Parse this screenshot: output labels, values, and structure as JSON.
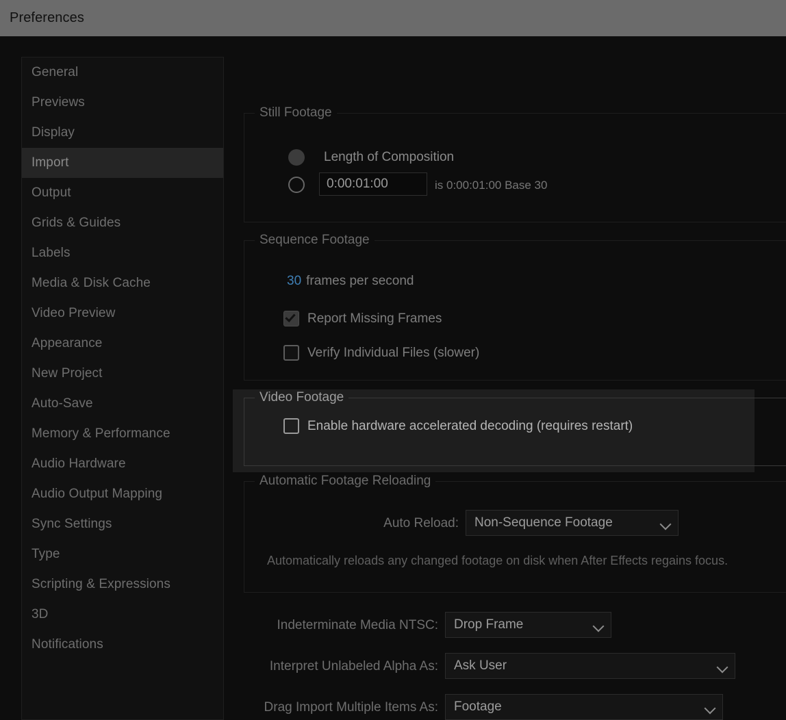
{
  "window": {
    "title": "Preferences"
  },
  "sidebar": {
    "items": [
      {
        "label": "General",
        "selected": false
      },
      {
        "label": "Previews",
        "selected": false
      },
      {
        "label": "Display",
        "selected": false
      },
      {
        "label": "Import",
        "selected": true
      },
      {
        "label": "Output",
        "selected": false
      },
      {
        "label": "Grids & Guides",
        "selected": false
      },
      {
        "label": "Labels",
        "selected": false
      },
      {
        "label": "Media & Disk Cache",
        "selected": false
      },
      {
        "label": "Video Preview",
        "selected": false
      },
      {
        "label": "Appearance",
        "selected": false
      },
      {
        "label": "New Project",
        "selected": false
      },
      {
        "label": "Auto-Save",
        "selected": false
      },
      {
        "label": "Memory & Performance",
        "selected": false
      },
      {
        "label": "Audio Hardware",
        "selected": false
      },
      {
        "label": "Audio Output Mapping",
        "selected": false
      },
      {
        "label": "Sync Settings",
        "selected": false
      },
      {
        "label": "Type",
        "selected": false
      },
      {
        "label": "Scripting & Expressions",
        "selected": false
      },
      {
        "label": "3D",
        "selected": false
      },
      {
        "label": "Notifications",
        "selected": false
      }
    ]
  },
  "still_footage": {
    "title": "Still Footage",
    "option_composition_label": "Length of Composition",
    "option_composition_selected": true,
    "option_custom_selected": false,
    "duration_value": "0:00:01:00",
    "duration_suffix": "is 0:00:01:00  Base 30"
  },
  "sequence_footage": {
    "title": "Sequence Footage",
    "fps_value": "30",
    "fps_label": "frames per second",
    "report_missing_frames_label": "Report Missing Frames",
    "report_missing_frames_checked": true,
    "verify_individual_files_label": "Verify Individual Files (slower)",
    "verify_individual_files_checked": false
  },
  "video_footage": {
    "title": "Video Footage",
    "hardware_decoding_label": "Enable hardware accelerated decoding (requires restart)",
    "hardware_decoding_checked": false,
    "highlighted": true
  },
  "automatic_footage_reloading": {
    "title": "Automatic Footage Reloading",
    "auto_reload_label": "Auto Reload:",
    "auto_reload_value": "Non-Sequence Footage",
    "description": "Automatically reloads any changed footage on disk when After Effects regains focus."
  },
  "bottom_options": {
    "ntsc_label": "Indeterminate Media NTSC:",
    "ntsc_value": "Drop Frame",
    "alpha_label": "Interpret Unlabeled Alpha As:",
    "alpha_value": "Ask User",
    "drag_import_label": "Drag Import Multiple Items As:",
    "drag_import_value": "Footage"
  },
  "colors": {
    "titlebar_bg": "#6b6b6b",
    "dialog_bg": "#0d0d0d",
    "sidebar_bg": "#111111",
    "selection_bg": "#252525",
    "highlight_bg": "#1e1e1e",
    "hot_text": "#3f7fb5",
    "label_text": "#6e6e6e",
    "value_text": "#9c9c9c"
  }
}
